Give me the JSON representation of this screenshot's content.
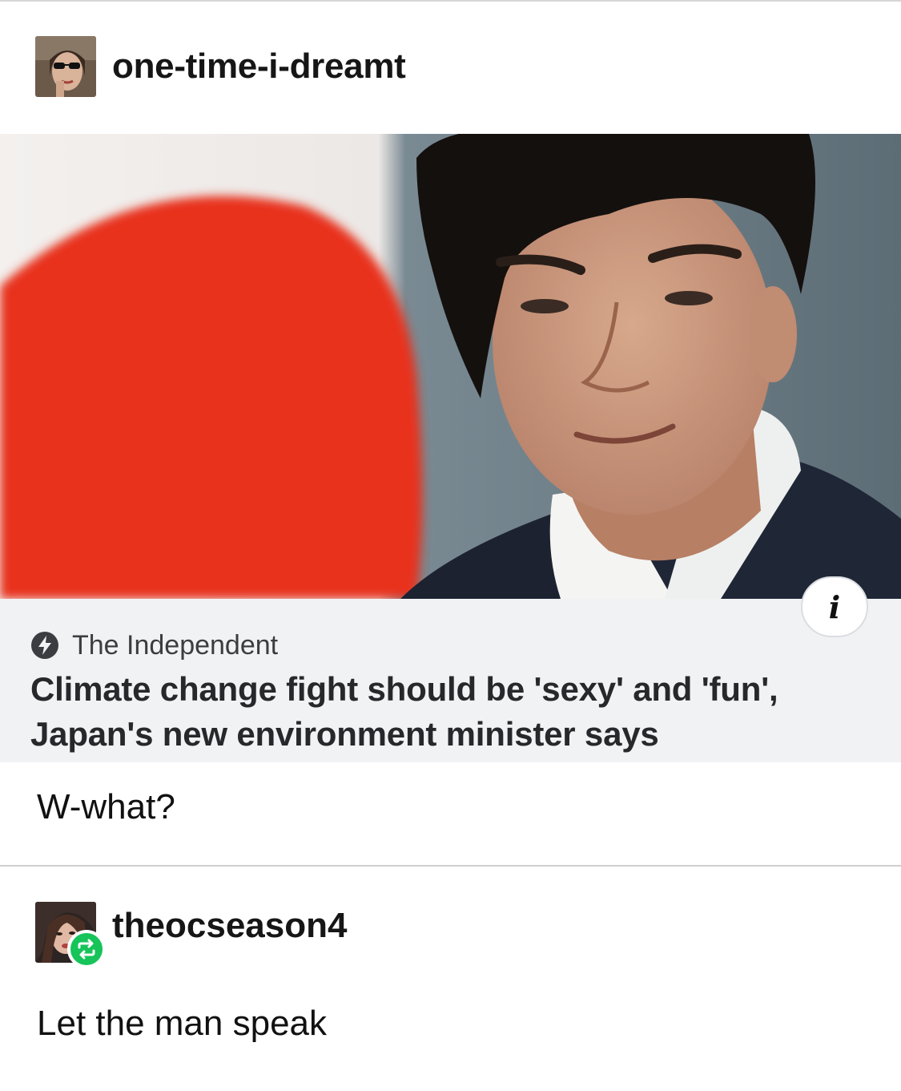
{
  "post": {
    "username": "one-time-i-dreamt",
    "avatar_icon": "user-avatar-woman-sunglasses",
    "article": {
      "source": "The Independent",
      "source_icon": "lightning-bolt-icon",
      "headline": "Climate change fight should be 'sexy' and 'fun', Japan's new environment minister says",
      "info_label": "i",
      "image_icon": "news-photo-man-with-japanese-flag"
    },
    "comment": "W-what?"
  },
  "reblog": {
    "username": "theocseason4",
    "avatar_icon": "user-avatar-woman",
    "badge_icon": "reblog-icon",
    "comment": "Let the man speak"
  },
  "colors": {
    "flag_red": "#e8321f",
    "card_background": "#f1f2f4",
    "reblog_green": "#16c45a"
  }
}
